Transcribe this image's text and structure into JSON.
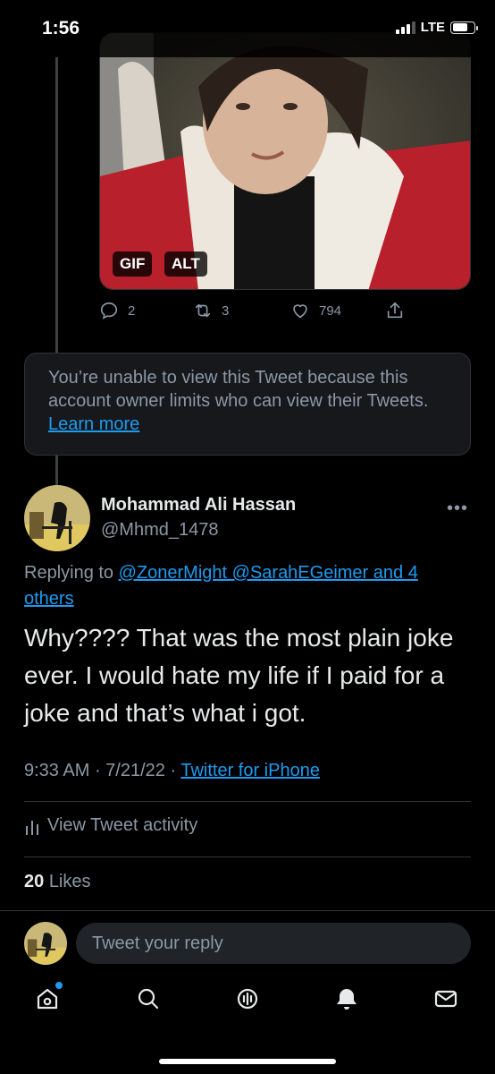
{
  "status_bar": {
    "time": "1:56",
    "network": "LTE"
  },
  "media": {
    "badge_gif": "GIF",
    "badge_alt": "ALT"
  },
  "tweet_actions": {
    "replies": "2",
    "retweets": "3",
    "likes": "794"
  },
  "unavailable": {
    "message": "You’re unable to view this Tweet because this account owner limits who can view their Tweets.",
    "link": "Learn more"
  },
  "author": {
    "name": "Mohammad Ali Hassan",
    "handle": "@Mhmd_1478",
    "more": "•••"
  },
  "replying": {
    "prefix": "Replying to",
    "mentions": "@ZonerMight @SarahEGeimer and 4 others"
  },
  "tweet": {
    "text": "Why???? That was the most plain joke ever. I would hate my life if I paid for a joke and that’s what i got.",
    "time": "9:33 AM",
    "date": "7/21/22",
    "source": "Twitter for iPhone"
  },
  "activity": {
    "label": "View Tweet activity"
  },
  "likes": {
    "count": "20",
    "label": "Likes"
  },
  "reply": {
    "placeholder": "Tweet your reply"
  },
  "tabs": [
    "home-icon",
    "search-icon",
    "spaces-icon",
    "notifications-icon",
    "messages-icon"
  ],
  "colors": {
    "accent": "#1d9bf0",
    "background": "#000000",
    "secondary_text": "#8b98a5"
  }
}
